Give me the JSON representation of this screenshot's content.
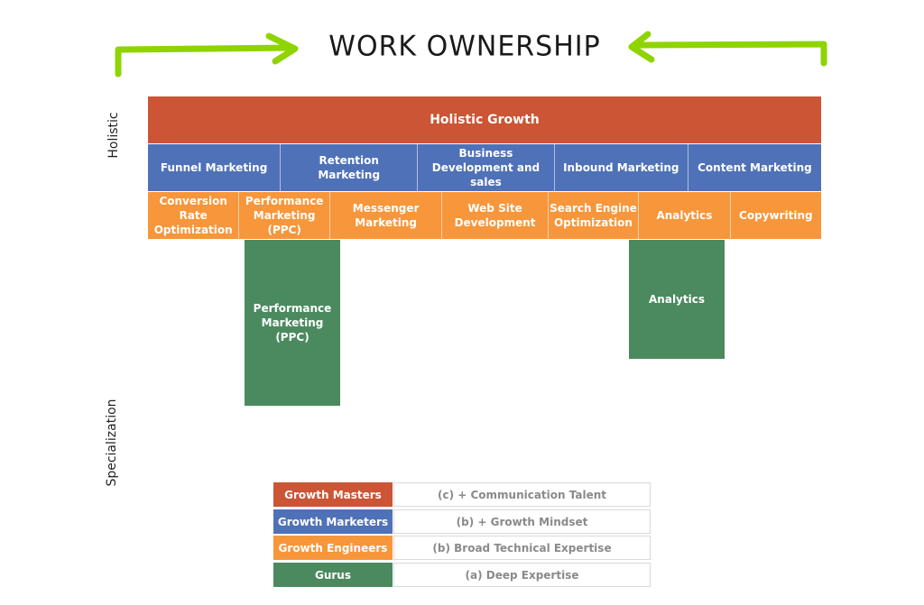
{
  "title": "WORK OWNERSHIP",
  "axis": {
    "top_label": "Holistic",
    "bottom_label": "Specialization"
  },
  "colors": {
    "masters": "#cb5534",
    "marketers": "#4f71b7",
    "engineers": "#f7963a",
    "gurus": "#4b8a5e",
    "arrow": "#8fd400"
  },
  "diagram": {
    "holistic_growth": "Holistic Growth",
    "marketers_row": [
      {
        "label": "Funnel Marketing"
      },
      {
        "label": "Retention Marketing"
      },
      {
        "label": "Business Development and sales"
      },
      {
        "label": "Inbound Marketing"
      },
      {
        "label": "Content Marketing"
      }
    ],
    "engineers_row": [
      {
        "label": "Conversion Rate Optimization"
      },
      {
        "label": "Performance Marketing (PPC)"
      },
      {
        "label": "Messenger Marketing"
      },
      {
        "label": "Web Site Development"
      },
      {
        "label": "Search Engine Optimization"
      },
      {
        "label": "Analytics"
      },
      {
        "label": "Copywriting"
      }
    ],
    "gurus": [
      {
        "label": "Performance Marketing (PPC)"
      },
      {
        "label": "Analytics"
      }
    ]
  },
  "legend": [
    {
      "key": "Growth Masters",
      "desc": "(c) + Communication Talent"
    },
    {
      "key": "Growth Marketers",
      "desc": "(b) + Growth Mindset"
    },
    {
      "key": "Growth Engineers",
      "desc": "(b) Broad Technical Expertise"
    },
    {
      "key": "Gurus",
      "desc": "(a) Deep Expertise"
    }
  ]
}
